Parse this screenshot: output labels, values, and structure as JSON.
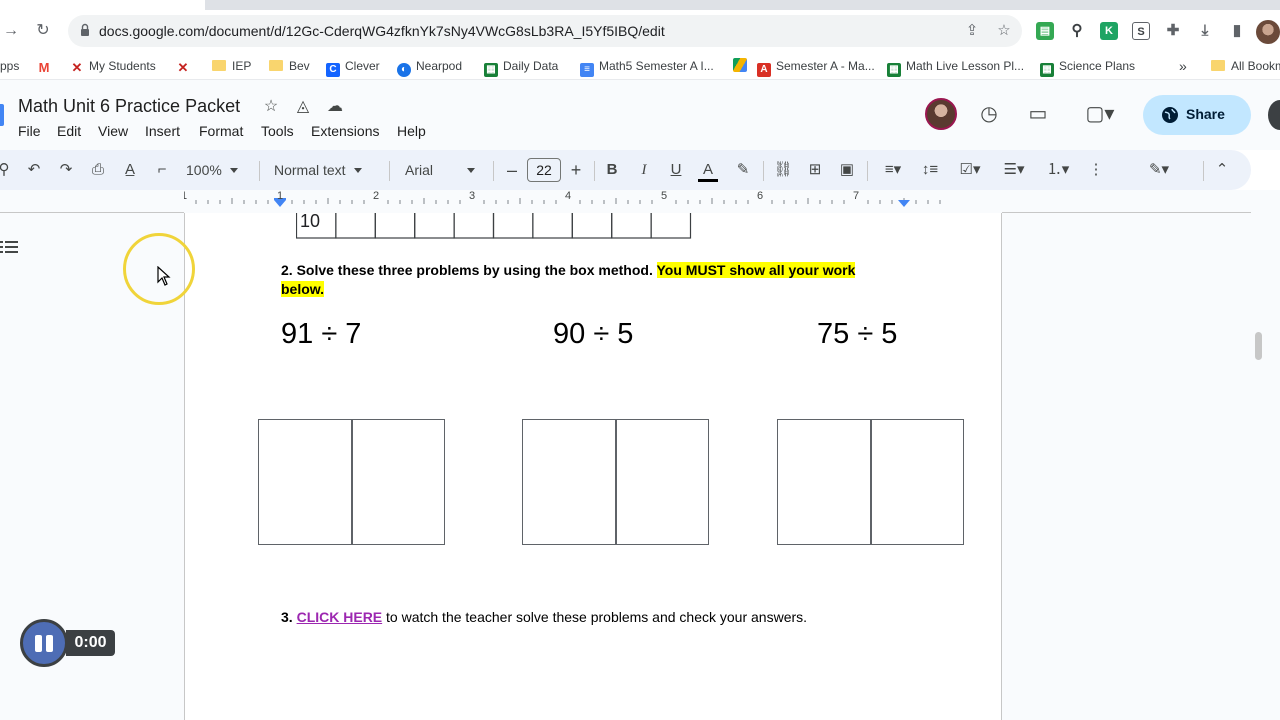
{
  "browser": {
    "url": "docs.google.com/document/d/12Gc-CderqWG4zfknYk7sNy4VWcG8sLb3RA_I5Yf5IBQ/edit",
    "bookmarks": [
      {
        "label": "pps",
        "icon": "apps-icon"
      },
      {
        "label": "",
        "icon": "gmail-icon"
      },
      {
        "label": "My Students",
        "icon": "x-logo-icon"
      },
      {
        "label": "",
        "icon": "x-logo-icon"
      },
      {
        "label": "IEP",
        "icon": "folder-icon"
      },
      {
        "label": "Bev",
        "icon": "folder-icon"
      },
      {
        "label": "Clever",
        "icon": "clever-icon"
      },
      {
        "label": "Nearpod",
        "icon": "nearpod-icon"
      },
      {
        "label": "Daily Data",
        "icon": "sheets-icon"
      },
      {
        "label": "Math5 Semester A I...",
        "icon": "docs-icon"
      },
      {
        "label": "",
        "icon": "drive-icon"
      },
      {
        "label": "Semester A - Ma...",
        "icon": "slides-icon"
      },
      {
        "label": "Math Live Lesson Pl...",
        "icon": "sheets-icon"
      },
      {
        "label": "Science Plans",
        "icon": "sheets-icon"
      },
      {
        "label": "»",
        "icon": "more-bookmarks"
      },
      {
        "label": "All Bookm",
        "icon": "folder-icon"
      }
    ]
  },
  "docs": {
    "title": "Math Unit 6 Practice Packet",
    "menu": [
      "File",
      "Edit",
      "View",
      "Insert",
      "Format",
      "Tools",
      "Extensions",
      "Help"
    ],
    "share_label": "Share",
    "toolbar": {
      "zoom": "100%",
      "style": "Normal text",
      "font": "Arial",
      "font_size": "22"
    },
    "accent": "#c2e7ff"
  },
  "ruler": {
    "labels": [
      "1",
      "1",
      "2",
      "3",
      "4",
      "5",
      "6",
      "7"
    ]
  },
  "document": {
    "grid_partial": "10",
    "instruction_main": "2. Solve these three problems by using the box method.",
    "instruction_highlight": "You MUST show all your work below.",
    "highlight_color": "#ffff00",
    "problems": [
      "91 ÷ 7",
      "90 ÷ 5",
      "75 ÷ 5"
    ],
    "line3_num": "3.",
    "line3_link": "CLICK HERE",
    "line3_rest": " to watch the teacher solve these problems and check your answers.",
    "link_color": "#9c27b0"
  },
  "player": {
    "time": "0:00"
  }
}
